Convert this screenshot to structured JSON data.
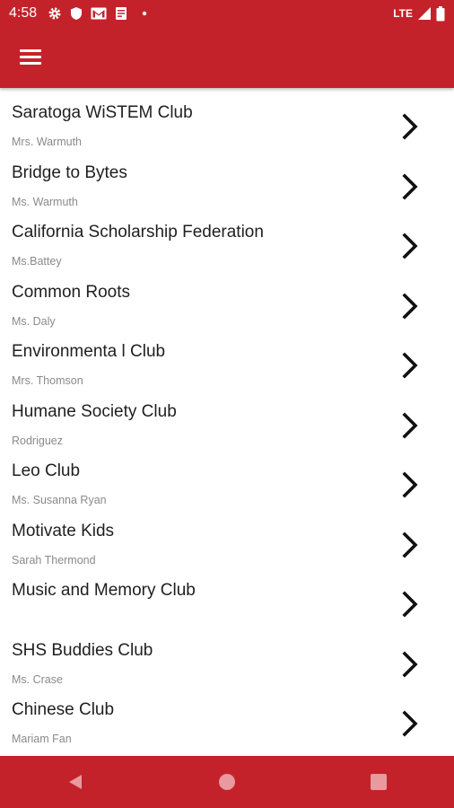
{
  "status_bar": {
    "time": "4:58",
    "network": "LTE",
    "icons": [
      "settings-gear-icon",
      "shield-icon",
      "gmail-icon",
      "document-icon",
      "dot-icon",
      "signal-icon",
      "battery-icon"
    ]
  },
  "app_bar": {
    "menu_icon": "hamburger-menu-icon"
  },
  "colors": {
    "primary": "#c4222a",
    "text": "#1f1f1f",
    "subtext": "#8a8a8a"
  },
  "clubs": [
    {
      "name": "Saratoga WiSTEM Club",
      "advisor": "Mrs. Warmuth"
    },
    {
      "name": "Bridge to Bytes",
      "advisor": "Ms. Warmuth"
    },
    {
      "name": "California Scholarship Federation",
      "advisor": "Ms.Battey"
    },
    {
      "name": "Common Roots",
      "advisor": "Ms. Daly"
    },
    {
      "name": "Environmenta l Club",
      "advisor": "Mrs. Thomson"
    },
    {
      "name": "Humane Society Club",
      "advisor": "Rodriguez"
    },
    {
      "name": "Leo Club",
      "advisor": "Ms. Susanna Ryan"
    },
    {
      "name": "Motivate Kids",
      "advisor": "Sarah Thermond"
    },
    {
      "name": "Music and Memory Club",
      "advisor": ""
    },
    {
      "name": "SHS Buddies Club",
      "advisor": "Ms. Crase"
    },
    {
      "name": "Chinese Club",
      "advisor": "Mariam Fan"
    }
  ],
  "nav_bar": {
    "buttons": [
      "back-triangle-icon",
      "home-circle-icon",
      "recents-square-icon"
    ]
  }
}
